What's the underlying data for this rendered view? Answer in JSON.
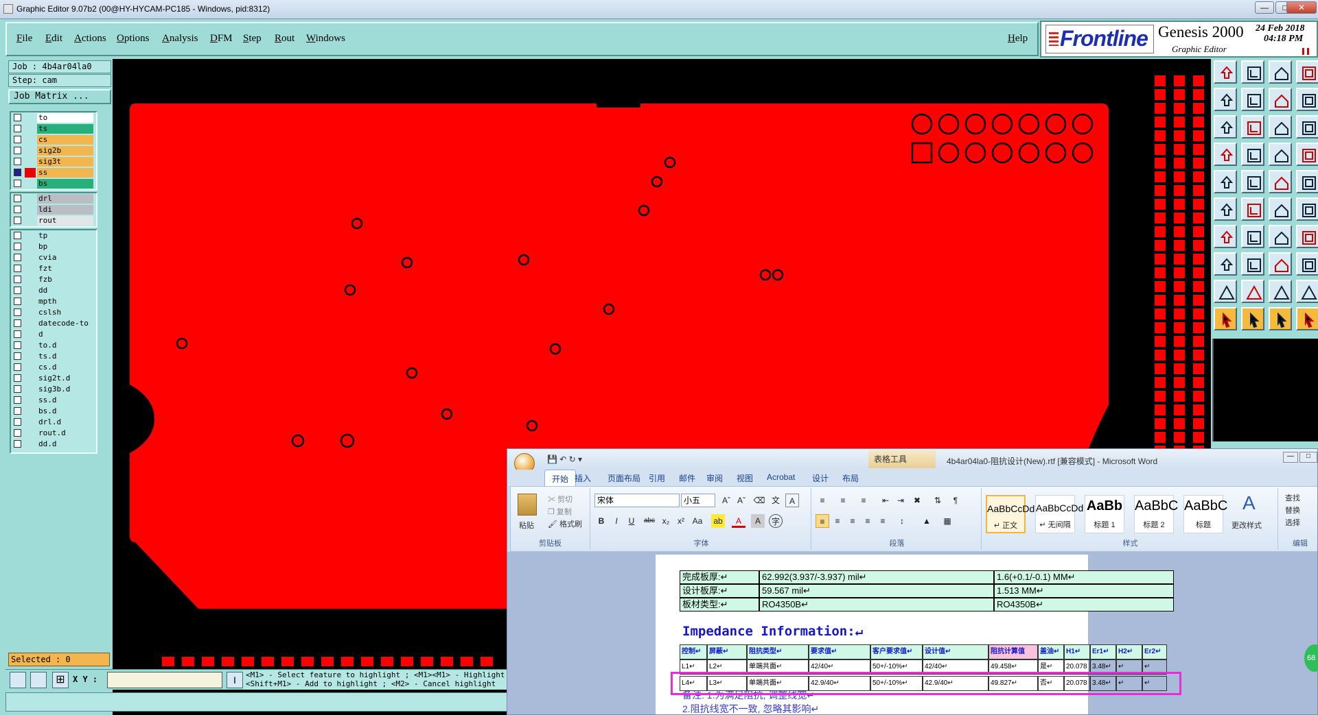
{
  "titlebar": {
    "title": "Graphic Editor 9.07b2 (00@HY-HYCAM-PC185 - Windows, pid:8312)"
  },
  "menu": {
    "items": [
      "File",
      "Edit",
      "Actions",
      "Options",
      "Analysis",
      "DFM",
      "Step",
      "Rout",
      "Windows"
    ],
    "help": "Help"
  },
  "logo": {
    "brand": "Frontline",
    "product": "Genesis 2000",
    "subtitle": "Graphic Editor",
    "date": "24 Feb 2018",
    "time": "04:18 PM"
  },
  "job": {
    "job": "Job : 4b4ar04la0",
    "step": "Step: cam",
    "matrix": "Job Matrix ..."
  },
  "layers": {
    "board": [
      {
        "name": "to",
        "color": "#ffffff",
        "on": false,
        "mark": "✓"
      },
      {
        "name": "ts",
        "color": "#27b07c",
        "on": false,
        "mark": "✓"
      },
      {
        "name": "cs",
        "color": "#f3b54d",
        "on": false,
        "mark": "✓"
      },
      {
        "name": "sig2b",
        "color": "#f3b54d",
        "on": false,
        "mark": "✓"
      },
      {
        "name": "sig3t",
        "color": "#f3b54d",
        "on": false,
        "mark": "✓"
      },
      {
        "name": "ss",
        "color": "#f3b54d",
        "on": true,
        "mark": "✓▪"
      },
      {
        "name": "bs",
        "color": "#27b07c",
        "on": false,
        "mark": "✓"
      }
    ],
    "drill": [
      {
        "name": "drl",
        "color": "#b9bec4"
      },
      {
        "name": "ldi",
        "color": "#b9bec4"
      },
      {
        "name": "rout",
        "color": "#e3e6e8"
      }
    ],
    "misc": [
      {
        "name": "tp",
        "mark": ""
      },
      {
        "name": "bp",
        "mark": ""
      },
      {
        "name": "cvia",
        "mark": ""
      },
      {
        "name": "fzt",
        "mark": ""
      },
      {
        "name": "fzb",
        "mark": ""
      },
      {
        "name": "dd",
        "mark": "✓"
      },
      {
        "name": "mpth",
        "mark": ""
      },
      {
        "name": "cslsh",
        "mark": ""
      },
      {
        "name": "datecode-to",
        "mark": ""
      },
      {
        "name": "d",
        "mark": ""
      },
      {
        "name": "to.d",
        "mark": "✓"
      },
      {
        "name": "ts.d",
        "mark": "✓"
      },
      {
        "name": "cs.d",
        "mark": "✓"
      },
      {
        "name": "sig2t.d",
        "mark": "✓"
      },
      {
        "name": "sig3b.d",
        "mark": "✓"
      },
      {
        "name": "ss.d",
        "mark": "✓"
      },
      {
        "name": "bs.d",
        "mark": "✓"
      },
      {
        "name": "drl.d",
        "mark": ""
      },
      {
        "name": "rout.d",
        "mark": ""
      },
      {
        "name": "dd.d",
        "mark": "✓"
      }
    ]
  },
  "selected": "Selected : 0",
  "cmd": {
    "xy_label": "X Y :",
    "message": "<M1> - Select feature to highlight ; <M1><M1> - Highlight ...\n<Shift+M1> - Add to highlight ; <M2> - Cancel highlight"
  },
  "colors": {
    "board": "#ff0000",
    "panel": "#9fdcd8",
    "active": "#f3b54d"
  },
  "word": {
    "title": "4b4ar04la0-阻抗设计(New).rtf [兼容模式] - Microsoft Word",
    "context_tab": "表格工具",
    "tabs": [
      "开始",
      "插入",
      "页面布局",
      "引用",
      "邮件",
      "审阅",
      "视图",
      "Acrobat",
      "设计",
      "布局"
    ],
    "clipboard": {
      "paste": "粘贴",
      "cut": "剪切",
      "copy": "复制",
      "format": "格式刷",
      "label": "剪贴板"
    },
    "font": {
      "name": "宋体",
      "size": "小五",
      "label": "字体"
    },
    "paragraph_label": "段落",
    "styles": [
      {
        "sample": "AaBbCcDd",
        "name": "↵ 正文"
      },
      {
        "sample": "AaBbCcDd",
        "name": "↵ 无间隔"
      },
      {
        "sample": "AaBb",
        "name": "标题 1"
      },
      {
        "sample": "AaBbC",
        "name": "标题 2"
      },
      {
        "sample": "AaBbC",
        "name": "标题"
      }
    ],
    "styles_label": "样式",
    "change_styles": "更改样式",
    "edit_items": [
      "查找",
      "替换",
      "选择"
    ],
    "edit_label": "编辑",
    "doc": {
      "rows": [
        [
          "完成板厚:↵",
          "62.992(3.937/-3.937) mil↵",
          "1.6(+0.1/-0.1) MM↵"
        ],
        [
          "设计板厚:↵",
          "59.567 mil↵",
          "1.513 MM↵"
        ],
        [
          "板材类型:↵",
          "RO4350B↵",
          "RO4350B↵"
        ]
      ],
      "impedance_title": "Impedance Information:↵",
      "imp_header": [
        "控制↵",
        "屏蔽↵",
        "阻抗类型↵",
        "要求值↵",
        "客户要求值↵",
        "设计值↵",
        "阻抗计算值",
        "盖油↵",
        "H1↵",
        "Er1↵",
        "H2↵",
        "Er2↵"
      ],
      "imp_rows": [
        [
          "L1↵",
          "L2↵",
          "单端共面↵",
          "42/40↵",
          "50+/-10%↵",
          "42/40↵",
          "49.458↵",
          "是↵",
          "20.078",
          "3.48↵",
          "↵",
          "↵"
        ],
        [
          "L4↵",
          "L3↵",
          "单端共面↵",
          "42.9/40↵",
          "50+/-10%↵",
          "42.9/40↵",
          "49.827↵",
          "否↵",
          "20.078",
          "3.48↵",
          "↵",
          "↵"
        ]
      ],
      "notes": [
        "备注: 1.为满足阻抗, 调整线宽↵",
        "2.阻抗线宽不一致, 忽略其影响↵"
      ]
    }
  }
}
